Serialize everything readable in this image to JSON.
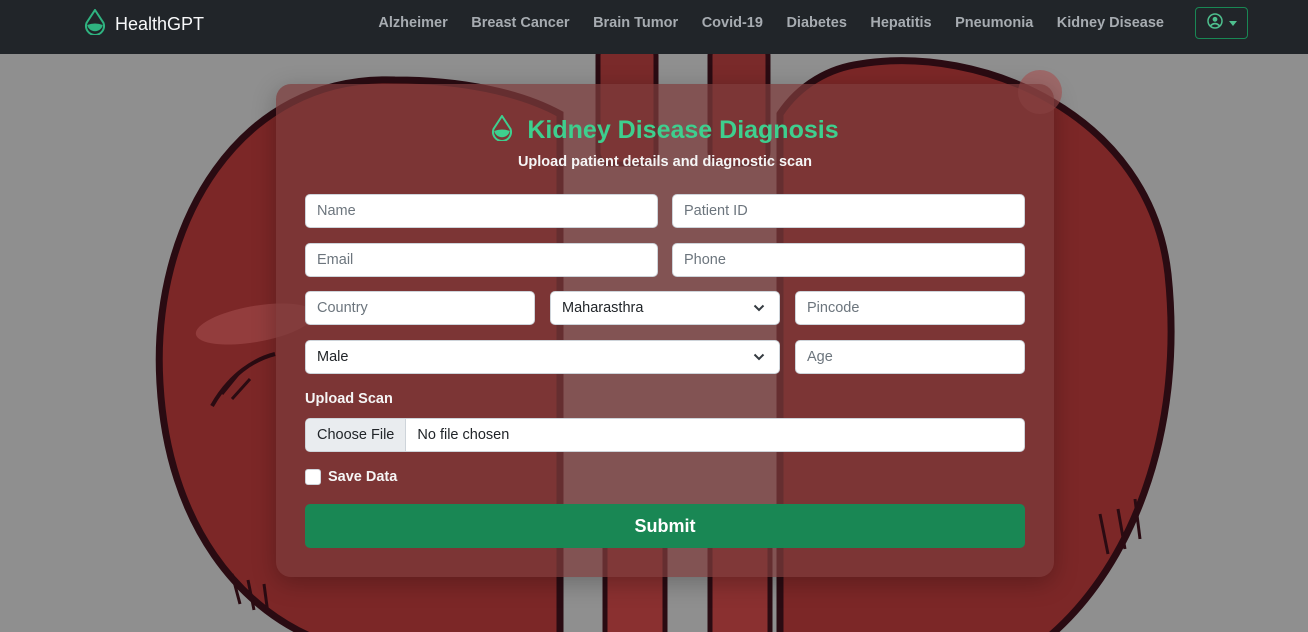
{
  "navbar": {
    "brand": "HealthGPT",
    "links": [
      "Alzheimer",
      "Breast Cancer",
      "Brain Tumor",
      "Covid-19",
      "Diabetes",
      "Hepatitis",
      "Pneumonia",
      "Kidney Disease"
    ],
    "user_icon": "user-circle-icon"
  },
  "form": {
    "title": "Kidney Disease Diagnosis",
    "subtitle": "Upload patient details and diagnostic scan",
    "name_placeholder": "Name",
    "patient_id_placeholder": "Patient ID",
    "email_placeholder": "Email",
    "phone_placeholder": "Phone",
    "country_placeholder": "Country",
    "state_selected": "Maharasthra",
    "pincode_placeholder": "Pincode",
    "gender_selected": "Male",
    "age_placeholder": "Age",
    "upload_label": "Upload Scan",
    "choose_file": "Choose File",
    "no_file": "No file chosen",
    "save_label": "Save Data",
    "submit_label": "Submit"
  },
  "colors": {
    "navbar_bg": "#212529",
    "accent": "#198754",
    "title_green": "#3ecf8e",
    "card_bg": "rgba(125,60,60,0.72)"
  }
}
